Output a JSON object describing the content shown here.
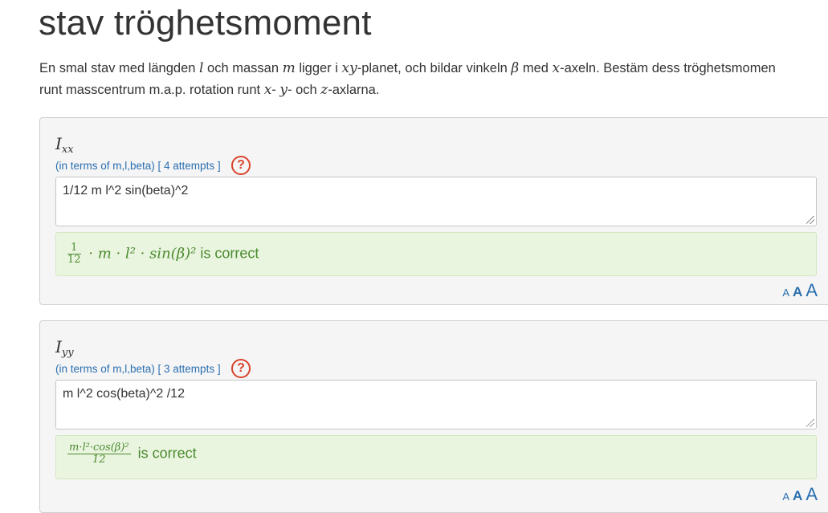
{
  "page": {
    "title": "stav tröghetsmoment",
    "description": {
      "line1": {
        "t1": "En smal stav med längden ",
        "m1": "l",
        "t2": " och massan ",
        "m2": "m",
        "t3": " ligger i ",
        "m3": "xy",
        "t4": "-planet, och bildar vinkeln ",
        "m4": "β",
        "t5": " med ",
        "m5": "x",
        "t6": "-axeln. Bestäm dess tröghetsmomen"
      },
      "line2": {
        "t1": "runt masscentrum m.a.p. rotation runt ",
        "m1": "x",
        "t2": "- ",
        "m2": "y",
        "t3": "- och ",
        "m3": "z",
        "t4": "-axlarna."
      }
    }
  },
  "questions": [
    {
      "label_main": "I",
      "label_sub": "xx",
      "hint": "(in terms of m,l,beta) [ 4 attempts ]",
      "help_icon": "?",
      "answer_value": "1/12 m l^2 sin(beta)^2",
      "result": {
        "frac_num": "1",
        "frac_den": "12",
        "expr": " · m · l² · sin(β)²",
        "status": " is correct"
      },
      "font_sizes": [
        "A",
        "A",
        "A"
      ]
    },
    {
      "label_main": "I",
      "label_sub": "yy",
      "hint": "(in terms of m,l,beta) [ 3 attempts ]",
      "help_icon": "?",
      "answer_value": "m l^2 cos(beta)^2 /12",
      "result": {
        "frac_num": "m·l²·cos(β)²",
        "frac_den": "12",
        "expr": "",
        "status": " is correct"
      },
      "font_sizes": [
        "A",
        "A",
        "A"
      ]
    }
  ],
  "colors": {
    "hint_blue": "#2a6fb0",
    "help_red": "#d9432b",
    "correct_green": "#4a8a2e",
    "correct_bg": "#eaf5e0"
  }
}
